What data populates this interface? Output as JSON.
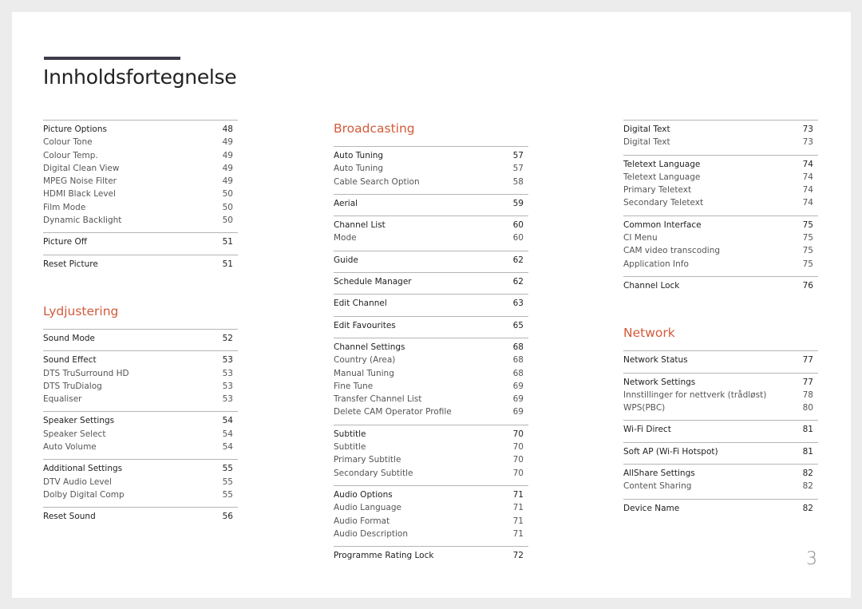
{
  "page_title": "Innholdsfortegnelse",
  "page_number": "3",
  "colors": {
    "section_title": "#d45a3a",
    "title_bar": "#3d3d4a"
  },
  "columns": [
    {
      "sections": [
        {
          "title": "",
          "groups": [
            {
              "main": {
                "label": "Picture Options",
                "page": "48"
              },
              "subs": [
                {
                  "label": "Colour Tone",
                  "page": "49"
                },
                {
                  "label": "Colour Temp.",
                  "page": "49"
                },
                {
                  "label": "Digital Clean View",
                  "page": "49"
                },
                {
                  "label": "MPEG Noise Filter",
                  "page": "49"
                },
                {
                  "label": "HDMI Black Level",
                  "page": "50"
                },
                {
                  "label": "Film Mode",
                  "page": "50"
                },
                {
                  "label": "Dynamic Backlight",
                  "page": "50"
                }
              ]
            },
            {
              "main": {
                "label": "Picture Off",
                "page": "51"
              },
              "subs": []
            },
            {
              "main": {
                "label": "Reset Picture",
                "page": "51"
              },
              "subs": []
            }
          ]
        },
        {
          "title": "Lydjustering",
          "groups": [
            {
              "main": {
                "label": "Sound Mode",
                "page": "52"
              },
              "subs": []
            },
            {
              "main": {
                "label": "Sound Effect",
                "page": "53"
              },
              "subs": [
                {
                  "label": "DTS TruSurround HD",
                  "page": "53"
                },
                {
                  "label": "DTS TruDialog",
                  "page": "53"
                },
                {
                  "label": "Equaliser",
                  "page": "53"
                }
              ]
            },
            {
              "main": {
                "label": "Speaker Settings",
                "page": "54"
              },
              "subs": [
                {
                  "label": "Speaker Select",
                  "page": "54"
                },
                {
                  "label": "Auto Volume",
                  "page": "54"
                }
              ]
            },
            {
              "main": {
                "label": "Additional Settings",
                "page": "55"
              },
              "subs": [
                {
                  "label": "DTV Audio Level",
                  "page": "55"
                },
                {
                  "label": "Dolby Digital Comp",
                  "page": "55"
                }
              ]
            },
            {
              "main": {
                "label": "Reset Sound",
                "page": "56"
              },
              "subs": []
            }
          ]
        }
      ]
    },
    {
      "sections": [
        {
          "title": "Broadcasting",
          "groups": [
            {
              "main": {
                "label": "Auto Tuning",
                "page": "57"
              },
              "subs": [
                {
                  "label": "Auto Tuning",
                  "page": "57"
                },
                {
                  "label": "Cable Search Option",
                  "page": "58"
                }
              ]
            },
            {
              "main": {
                "label": "Aerial",
                "page": "59"
              },
              "subs": []
            },
            {
              "main": {
                "label": "Channel List",
                "page": "60"
              },
              "subs": [
                {
                  "label": "Mode",
                  "page": "60"
                }
              ]
            },
            {
              "main": {
                "label": "Guide",
                "page": "62"
              },
              "subs": []
            },
            {
              "main": {
                "label": "Schedule Manager",
                "page": "62"
              },
              "subs": []
            },
            {
              "main": {
                "label": "Edit Channel",
                "page": "63"
              },
              "subs": []
            },
            {
              "main": {
                "label": "Edit Favourites",
                "page": "65"
              },
              "subs": []
            },
            {
              "main": {
                "label": "Channel Settings",
                "page": "68"
              },
              "subs": [
                {
                  "label": "Country (Area)",
                  "page": "68"
                },
                {
                  "label": "Manual Tuning",
                  "page": "68"
                },
                {
                  "label": "Fine Tune",
                  "page": "69"
                },
                {
                  "label": "Transfer Channel List",
                  "page": "69"
                },
                {
                  "label": "Delete CAM Operator Profile",
                  "page": "69"
                }
              ]
            },
            {
              "main": {
                "label": "Subtitle",
                "page": "70"
              },
              "subs": [
                {
                  "label": "Subtitle",
                  "page": "70"
                },
                {
                  "label": "Primary Subtitle",
                  "page": "70"
                },
                {
                  "label": "Secondary Subtitle",
                  "page": "70"
                }
              ]
            },
            {
              "main": {
                "label": "Audio Options",
                "page": "71"
              },
              "subs": [
                {
                  "label": "Audio Language",
                  "page": "71"
                },
                {
                  "label": "Audio Format",
                  "page": "71"
                },
                {
                  "label": "Audio Description",
                  "page": "71"
                }
              ]
            },
            {
              "main": {
                "label": "Programme Rating Lock",
                "page": "72"
              },
              "subs": []
            }
          ]
        }
      ]
    },
    {
      "sections": [
        {
          "title": "",
          "groups": [
            {
              "main": {
                "label": "Digital Text",
                "page": "73"
              },
              "subs": [
                {
                  "label": "Digital Text",
                  "page": "73"
                }
              ]
            },
            {
              "main": {
                "label": "Teletext Language",
                "page": "74"
              },
              "subs": [
                {
                  "label": "Teletext Language",
                  "page": "74"
                },
                {
                  "label": "Primary Teletext",
                  "page": "74"
                },
                {
                  "label": "Secondary Teletext",
                  "page": "74"
                }
              ]
            },
            {
              "main": {
                "label": "Common Interface",
                "page": "75"
              },
              "subs": [
                {
                  "label": "CI Menu",
                  "page": "75"
                },
                {
                  "label": "CAM video transcoding",
                  "page": "75"
                },
                {
                  "label": "Application Info",
                  "page": "75"
                }
              ]
            },
            {
              "main": {
                "label": "Channel Lock",
                "page": "76"
              },
              "subs": []
            }
          ]
        },
        {
          "title": "Network",
          "groups": [
            {
              "main": {
                "label": "Network Status",
                "page": "77"
              },
              "subs": []
            },
            {
              "main": {
                "label": "Network Settings",
                "page": "77"
              },
              "subs": [
                {
                  "label": "Innstillinger for nettverk (trådløst)",
                  "page": "78"
                },
                {
                  "label": "WPS(PBC)",
                  "page": "80"
                }
              ]
            },
            {
              "main": {
                "label": "Wi-Fi Direct",
                "page": "81"
              },
              "subs": []
            },
            {
              "main": {
                "label": "Soft AP (Wi-Fi Hotspot)",
                "page": "81"
              },
              "subs": []
            },
            {
              "main": {
                "label": "AllShare Settings",
                "page": "82"
              },
              "subs": [
                {
                  "label": "Content Sharing",
                  "page": "82"
                }
              ]
            },
            {
              "main": {
                "label": "Device Name",
                "page": "82"
              },
              "subs": []
            }
          ]
        }
      ]
    }
  ]
}
